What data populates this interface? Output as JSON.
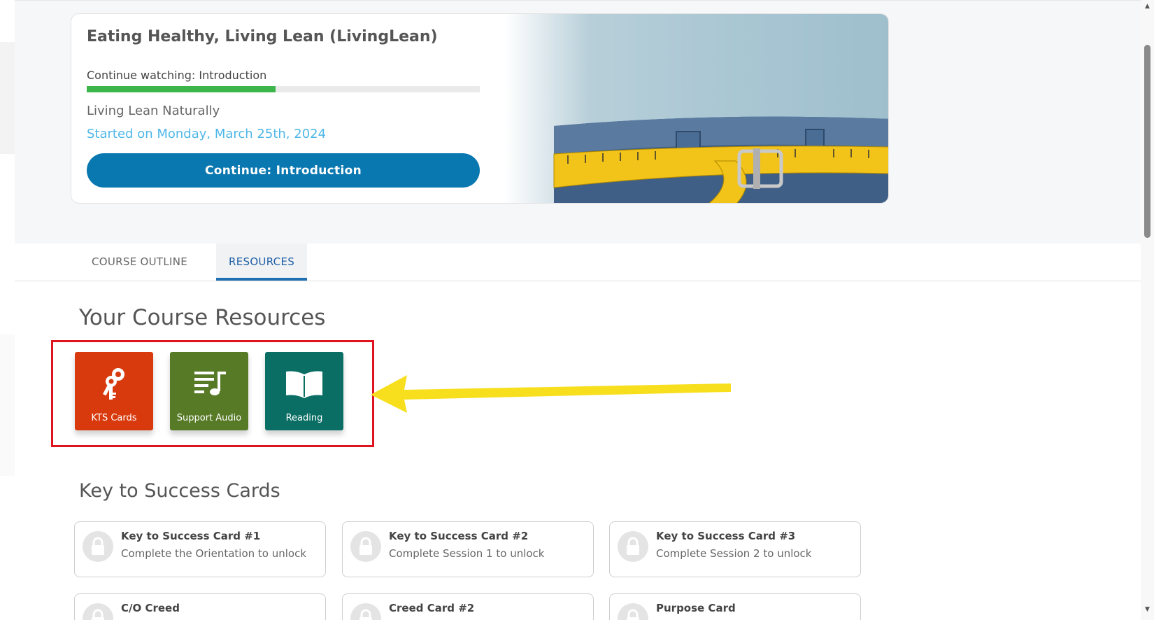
{
  "course": {
    "title": "Eating Healthy, Living Lean (LivingLean)",
    "continue_watching": "Continue watching: Introduction",
    "progress_fraction": 0.48,
    "subtitle": "Living Lean Naturally",
    "started": "Started on Monday, March 25th, 2024",
    "continue_button": "Continue: Introduction",
    "image_name": "jeans-with-measuring-tape-image"
  },
  "tabs": [
    {
      "label": "COURSE OUTLINE",
      "active": false
    },
    {
      "label": "RESOURCES",
      "active": true
    }
  ],
  "resources": {
    "heading": "Your Course Resources",
    "tiles": [
      {
        "label": "KTS Cards",
        "icon": "keys-icon",
        "color": "#d83a0e"
      },
      {
        "label": "Support Audio",
        "icon": "playlist-music-icon",
        "color": "#577a27"
      },
      {
        "label": "Reading",
        "icon": "open-book-icon",
        "color": "#0a6e64"
      }
    ],
    "highlight_color": "#e0141e",
    "arrow_color": "#f7df1e"
  },
  "kts_section": {
    "heading": "Key to Success Cards",
    "cards": [
      {
        "title": "Key to Success Card #1",
        "subtitle": "Complete the Orientation to unlock",
        "icon": "lock-icon"
      },
      {
        "title": "Key to Success Card #2",
        "subtitle": "Complete Session 1 to unlock",
        "icon": "lock-icon"
      },
      {
        "title": "Key to Success Card #3",
        "subtitle": "Complete Session 2 to unlock",
        "icon": "lock-icon"
      },
      {
        "title": "C/O Creed",
        "subtitle": "",
        "icon": "lock-icon"
      },
      {
        "title": "Creed Card #2",
        "subtitle": "",
        "icon": "lock-icon"
      },
      {
        "title": "Purpose Card",
        "subtitle": "",
        "icon": "lock-icon"
      }
    ]
  },
  "colors": {
    "primary_button": "#0a78b0",
    "progress_green": "#3cb54a",
    "started_blue": "#4fb7e8",
    "tab_active": "#1f5fa6"
  }
}
